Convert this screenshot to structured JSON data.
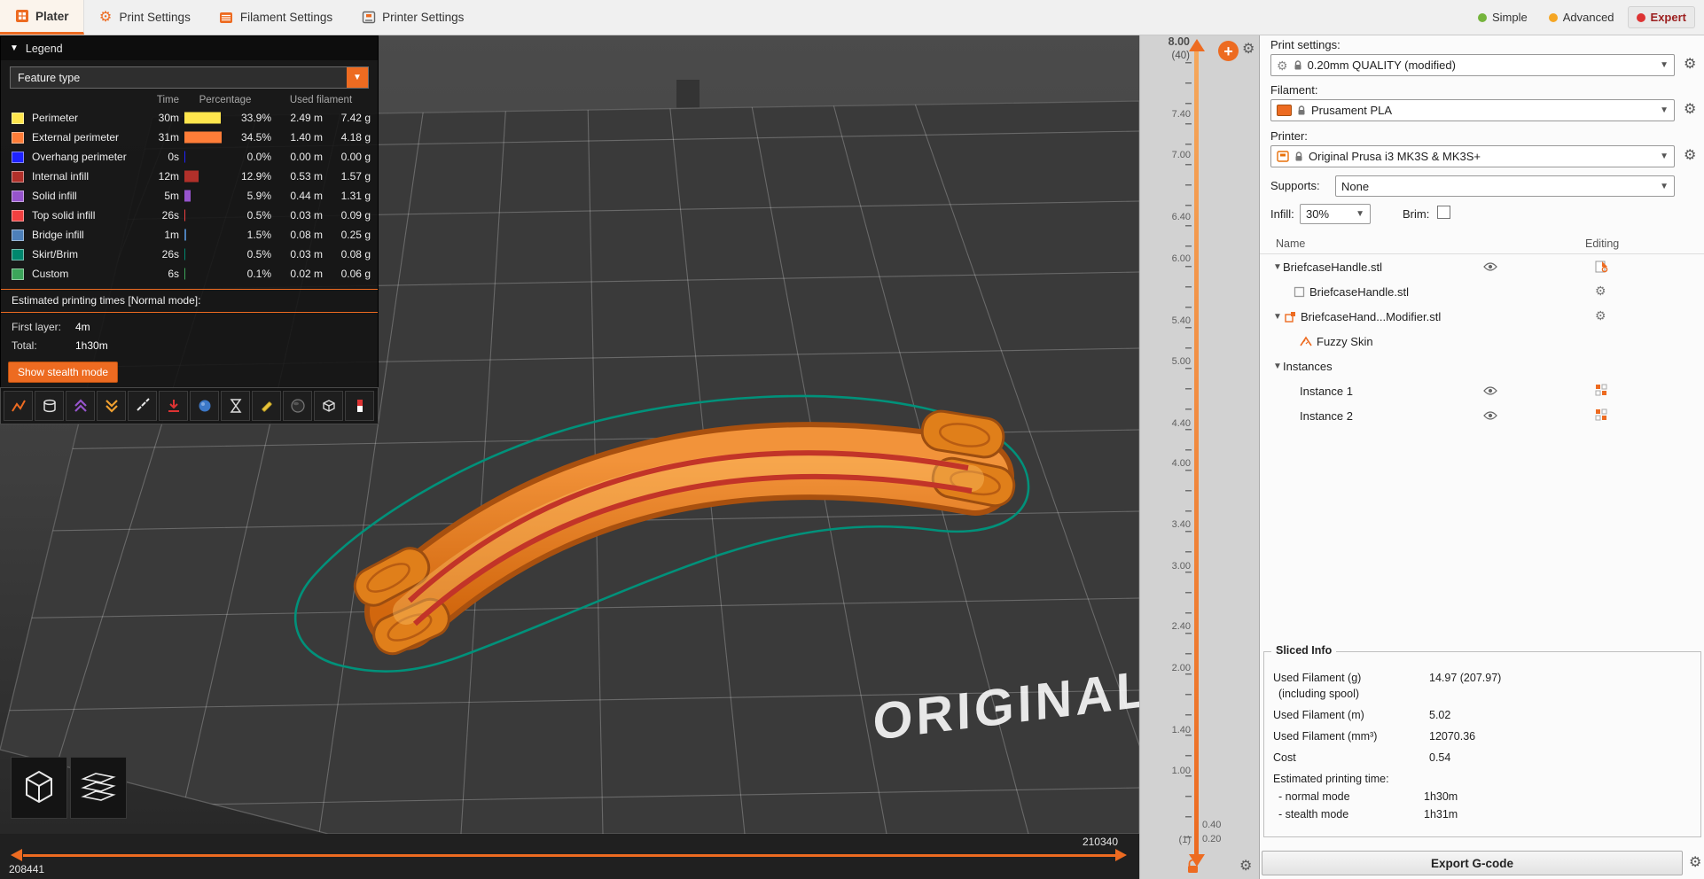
{
  "tabbar": {
    "tabs": [
      {
        "label": "Plater"
      },
      {
        "label": "Print Settings"
      },
      {
        "label": "Filament Settings"
      },
      {
        "label": "Printer Settings"
      }
    ],
    "modes": [
      {
        "label": "Simple",
        "color": "#75b43c"
      },
      {
        "label": "Advanced",
        "color": "#f5a623"
      },
      {
        "label": "Expert",
        "color": "#dd3333"
      }
    ]
  },
  "legend": {
    "title": "Legend",
    "view_type": "Feature type",
    "col_time": "Time",
    "col_percentage": "Percentage",
    "col_used_filament": "Used filament",
    "rows": [
      {
        "name": "Perimeter",
        "color": "#FFE64D",
        "time": "30m",
        "pct": 33.9,
        "percent": "33.9%",
        "meters": "2.49 m",
        "grams": "7.42 g"
      },
      {
        "name": "External perimeter",
        "color": "#FF7D38",
        "time": "31m",
        "pct": 34.5,
        "percent": "34.5%",
        "meters": "1.40 m",
        "grams": "4.18 g"
      },
      {
        "name": "Overhang perimeter",
        "color": "#1F23FF",
        "time": "0s",
        "pct": 0.0,
        "percent": "0.0%",
        "meters": "0.00 m",
        "grams": "0.00 g"
      },
      {
        "name": "Internal infill",
        "color": "#B1302A",
        "time": "12m",
        "pct": 12.9,
        "percent": "12.9%",
        "meters": "0.53 m",
        "grams": "1.57 g"
      },
      {
        "name": "Solid infill",
        "color": "#9654CC",
        "time": "5m",
        "pct": 5.9,
        "percent": "5.9%",
        "meters": "0.44 m",
        "grams": "1.31 g"
      },
      {
        "name": "Top solid infill",
        "color": "#F04040",
        "time": "26s",
        "pct": 0.5,
        "percent": "0.5%",
        "meters": "0.03 m",
        "grams": "0.09 g"
      },
      {
        "name": "Bridge infill",
        "color": "#4D80BA",
        "time": "1m",
        "pct": 1.5,
        "percent": "1.5%",
        "meters": "0.08 m",
        "grams": "0.25 g"
      },
      {
        "name": "Skirt/Brim",
        "color": "#00876E",
        "time": "26s",
        "pct": 0.5,
        "percent": "0.5%",
        "meters": "0.03 m",
        "grams": "0.08 g"
      },
      {
        "name": "Custom",
        "color": "#3CA55A",
        "time": "6s",
        "pct": 0.1,
        "percent": "0.1%",
        "meters": "0.02 m",
        "grams": "0.06 g"
      }
    ],
    "estimates_title": "Estimated printing times [Normal mode]:",
    "first_layer_label": "First layer:",
    "first_layer_value": "4m",
    "total_label": "Total:",
    "total_value": "1h30m",
    "stealth_button": "Show stealth mode"
  },
  "viewport": {
    "bed_text": "ORIGINAL P",
    "move_slider": {
      "left_value": "208441",
      "right_value": "210340"
    }
  },
  "layer_slider": {
    "current_value": "8.00",
    "current_layer": "(40)",
    "tick_labels": [
      "7.40",
      "7.00",
      "6.40",
      "6.00",
      "5.40",
      "5.00",
      "4.40",
      "4.00",
      "3.40",
      "3.00",
      "2.40",
      "2.00",
      "1.40",
      "1.00",
      "0.40",
      "0.20"
    ],
    "bottom_layer": "(1)"
  },
  "sidebar": {
    "print_settings_label": "Print settings:",
    "print_settings_value": "0.20mm QUALITY (modified)",
    "filament_label": "Filament:",
    "filament_value": "Prusament PLA",
    "filament_color": "#ED6B21",
    "printer_label": "Printer:",
    "printer_value": "Original Prusa i3 MK3S & MK3S+",
    "supports_label": "Supports:",
    "supports_value": "None",
    "infill_label": "Infill:",
    "infill_value": "30%",
    "brim_label": "Brim:",
    "tree": {
      "name_header": "Name",
      "editing_header": "Editing",
      "rows": [
        {
          "label": "BriefcaseHandle.stl"
        },
        {
          "label": "BriefcaseHandle.stl"
        },
        {
          "label": "BriefcaseHand...Modifier.stl"
        },
        {
          "label": "Fuzzy Skin"
        },
        {
          "label": "Instances"
        },
        {
          "label": "Instance 1"
        },
        {
          "label": "Instance 2"
        }
      ]
    },
    "sliced_info": {
      "title": "Sliced Info",
      "rows": [
        {
          "label": "Used Filament (g)",
          "value": "14.97 (207.97)"
        },
        {
          "label": "(including spool)",
          "value": ""
        },
        {
          "label": "Used Filament (m)",
          "value": "5.02"
        },
        {
          "label": "Used Filament (mm³)",
          "value": "12070.36"
        },
        {
          "label": "Cost",
          "value": "0.54"
        },
        {
          "label": "Estimated printing time:",
          "value": ""
        },
        {
          "label": "- normal mode",
          "value": "1h30m"
        },
        {
          "label": "- stealth mode",
          "value": "1h31m"
        }
      ]
    },
    "export_button": "Export G-code"
  }
}
